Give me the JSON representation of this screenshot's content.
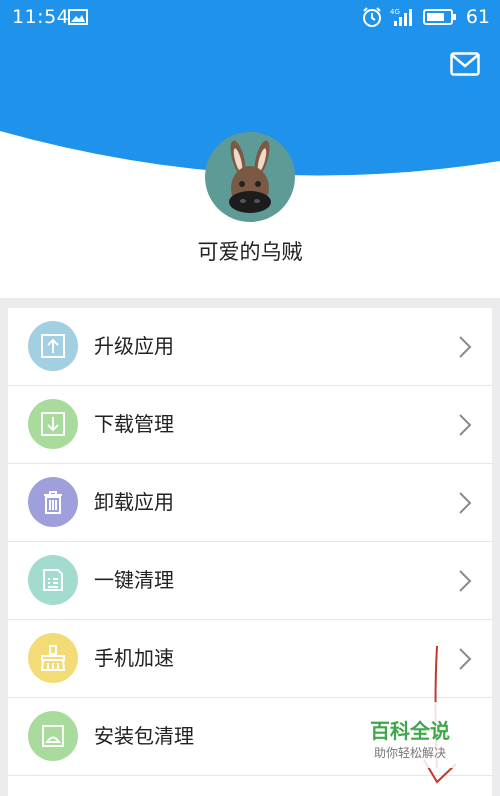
{
  "status_bar": {
    "time": "11:54",
    "signal_label": "4G",
    "battery": "61"
  },
  "profile": {
    "username": "可爱的乌贼"
  },
  "menu": {
    "items": [
      {
        "label": "升级应用",
        "icon": "upgrade-icon",
        "color": "#a3cfe3"
      },
      {
        "label": "下载管理",
        "icon": "download-icon",
        "color": "#a9db9d"
      },
      {
        "label": "卸载应用",
        "icon": "trash-icon",
        "color": "#9f9fdc"
      },
      {
        "label": "一键清理",
        "icon": "clean-document-icon",
        "color": "#a3dccf"
      },
      {
        "label": "手机加速",
        "icon": "broom-icon",
        "color": "#f3dc76"
      },
      {
        "label": "安装包清理",
        "icon": "package-clean-icon",
        "color": "#a9db9d"
      }
    ]
  },
  "watermark": {
    "title": "百科全说",
    "subtitle": "助你轻松解决"
  },
  "colors": {
    "brand_blue": "#1f93ec",
    "annotation_red": "#c0392b"
  }
}
